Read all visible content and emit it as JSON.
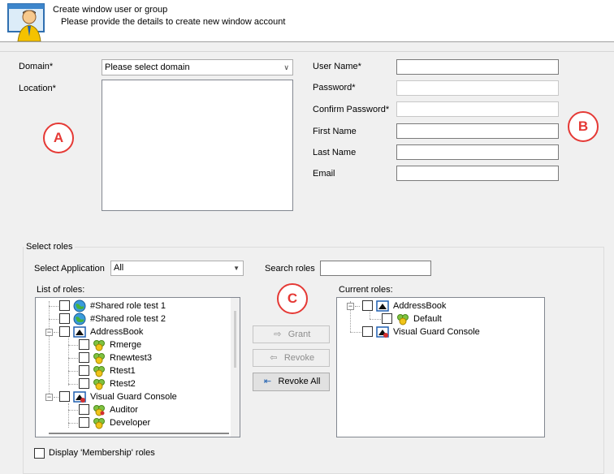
{
  "header": {
    "title": "Create window user or group",
    "subtitle": "Please provide the details to create new window account"
  },
  "form": {
    "domain_label": "Domain*",
    "domain_value": "Please select domain",
    "location_label": "Location*",
    "username_label": "User Name*",
    "password_label": "Password*",
    "confirm_label": "Confirm Password*",
    "firstname_label": "First Name",
    "lastname_label": "Last Name",
    "email_label": "Email"
  },
  "roles": {
    "group_title": "Select roles",
    "select_app_label": "Select Application",
    "select_app_value": "All",
    "search_label": "Search roles",
    "list_label": "List of roles:",
    "current_label": "Current roles:",
    "membership_label": "Display 'Membership' roles",
    "grant_label": "Grant",
    "revoke_label": "Revoke",
    "revoke_all_label": "Revoke All",
    "list_items": [
      "#Shared role test 1",
      "#Shared role test 2",
      "AddressBook",
      "Rmerge",
      "Rnewtest3",
      "Rtest1",
      "Rtest2",
      "Visual Guard Console",
      "Auditor",
      "Developer"
    ],
    "current_items": [
      "AddressBook",
      "Default",
      "Visual Guard Console"
    ]
  },
  "annotations": {
    "a": "A",
    "b": "B",
    "c": "C"
  },
  "colors": {
    "annotation": "#e53935",
    "background": "#f0f0f0"
  }
}
